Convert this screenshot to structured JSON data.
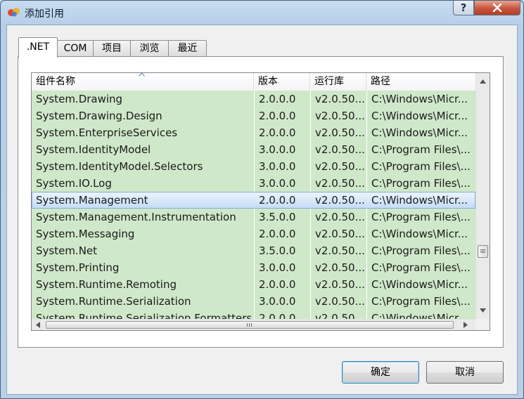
{
  "window": {
    "title": "添加引用",
    "help_label": "?",
    "icons": {
      "app": "app-logo-icon",
      "close": "close-icon"
    }
  },
  "tabs": [
    {
      "label": ".NET",
      "active": true
    },
    {
      "label": "COM",
      "active": false
    },
    {
      "label": "项目",
      "active": false
    },
    {
      "label": "浏览",
      "active": false
    },
    {
      "label": "最近",
      "active": false
    }
  ],
  "list": {
    "columns": [
      "组件名称",
      "版本",
      "运行库",
      "路径"
    ],
    "sorted_column": "组件名称",
    "rows": [
      {
        "name": "System.Drawing",
        "version": "2.0.0.0",
        "runtime": "v2.0.50...",
        "path": "C:\\Windows\\Micr..."
      },
      {
        "name": "System.Drawing.Design",
        "version": "2.0.0.0",
        "runtime": "v2.0.50...",
        "path": "C:\\Windows\\Micr..."
      },
      {
        "name": "System.EnterpriseServices",
        "version": "2.0.0.0",
        "runtime": "v2.0.50...",
        "path": "C:\\Windows\\Micr..."
      },
      {
        "name": "System.IdentityModel",
        "version": "3.0.0.0",
        "runtime": "v2.0.50...",
        "path": "C:\\Program Files\\..."
      },
      {
        "name": "System.IdentityModel.Selectors",
        "version": "3.0.0.0",
        "runtime": "v2.0.50...",
        "path": "C:\\Program Files\\..."
      },
      {
        "name": "System.IO.Log",
        "version": "3.0.0.0",
        "runtime": "v2.0.50...",
        "path": "C:\\Program Files\\..."
      },
      {
        "name": "System.Management",
        "version": "2.0.0.0",
        "runtime": "v2.0.50...",
        "path": "C:\\Windows\\Micr...",
        "selected": true
      },
      {
        "name": "System.Management.Instrumentation",
        "version": "3.5.0.0",
        "runtime": "v2.0.50...",
        "path": "C:\\Program Files\\..."
      },
      {
        "name": "System.Messaging",
        "version": "2.0.0.0",
        "runtime": "v2.0.50...",
        "path": "C:\\Windows\\Micr..."
      },
      {
        "name": "System.Net",
        "version": "3.5.0.0",
        "runtime": "v2.0.50...",
        "path": "C:\\Program Files\\..."
      },
      {
        "name": "System.Printing",
        "version": "3.0.0.0",
        "runtime": "v2.0.50...",
        "path": "C:\\Program Files\\..."
      },
      {
        "name": "System.Runtime.Remoting",
        "version": "2.0.0.0",
        "runtime": "v2.0.50...",
        "path": "C:\\Windows\\Micr..."
      },
      {
        "name": "System.Runtime.Serialization",
        "version": "3.0.0.0",
        "runtime": "v2.0.50...",
        "path": "C:\\Program Files\\..."
      },
      {
        "name": "System.Runtime.Serialization.Formatters.Soap",
        "version": "2.0.0.0",
        "runtime": "v2.0.50...",
        "path": "C:\\Windows\\Micr..."
      }
    ]
  },
  "colors": {
    "row_bg": "#cfe8c9",
    "selected_row": "#c3dcf5",
    "close_button": "#c9533b"
  },
  "buttons": {
    "ok": "确定",
    "cancel": "取消"
  }
}
